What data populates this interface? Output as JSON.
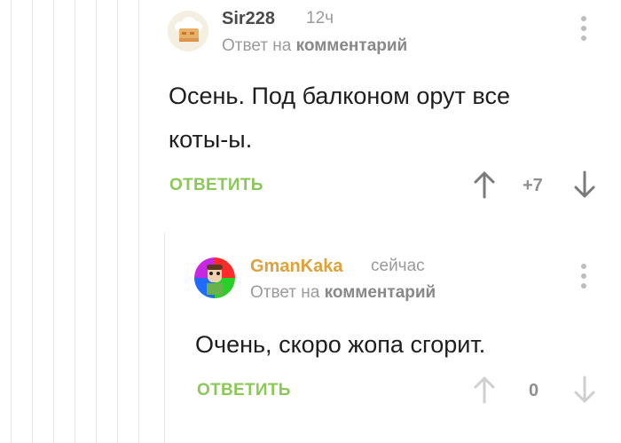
{
  "comment1": {
    "username": "Sir228",
    "time": "12ч",
    "reply_prefix": "Ответ на",
    "reply_target": "комментарий",
    "body_line1": "Осень. Под балконом орут все",
    "body_line2": "коты-ы.",
    "reply_label": "ОТВЕТИТЬ",
    "score": "+7",
    "username_color": "#4a4a4a"
  },
  "comment2": {
    "username": "GmanKaka",
    "time": "сейчас",
    "reply_prefix": "Ответ на",
    "reply_target": "комментарий",
    "body": "Очень, скоро жопа сгорит.",
    "reply_label": "ОТВЕТИТЬ",
    "score": "0",
    "username_color": "#e0a13a"
  },
  "colors": {
    "accent_green": "#8ac858",
    "muted": "#9a9a9a",
    "thread_line": "#e6e6e6"
  }
}
